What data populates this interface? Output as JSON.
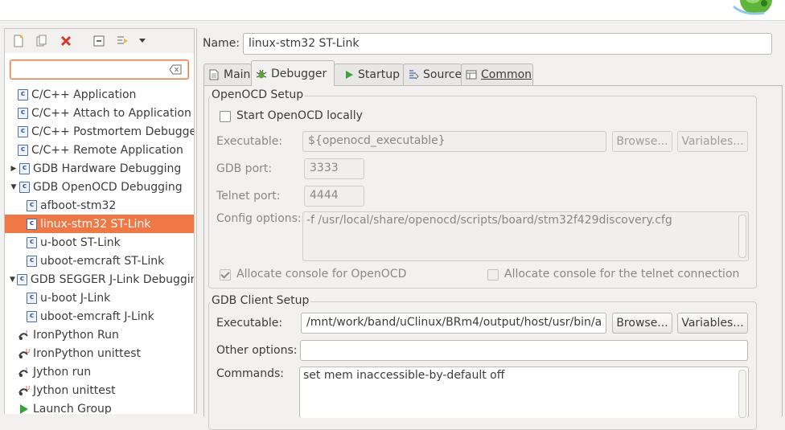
{
  "left_panel": {
    "toolbar": {
      "new_tooltip_icon": "new-config-icon",
      "duplicate_icon": "duplicate-icon",
      "delete_icon": "delete-icon",
      "collapse_icon": "collapse-all-icon",
      "filter_icon": "filter-icon",
      "menu_icon": "dropdown-menu-icon"
    },
    "filter": {
      "value": "",
      "placeholder": ""
    },
    "tree": [
      {
        "label": "C/C++ Application",
        "level": 1,
        "icon": "c-config-icon"
      },
      {
        "label": "C/C++ Attach to Application",
        "level": 1,
        "icon": "c-config-icon"
      },
      {
        "label": "C/C++ Postmortem Debugger",
        "level": 1,
        "icon": "c-config-icon"
      },
      {
        "label": "C/C++ Remote Application",
        "level": 1,
        "icon": "c-config-icon"
      },
      {
        "label": "GDB Hardware Debugging",
        "level": 0,
        "icon": "c-config-icon",
        "expanded": false
      },
      {
        "label": "GDB OpenOCD Debugging",
        "level": 0,
        "icon": "c-config-icon",
        "expanded": true
      },
      {
        "label": "afboot-stm32",
        "level": 2,
        "icon": "c-config-icon"
      },
      {
        "label": "linux-stm32 ST-Link",
        "level": 2,
        "icon": "c-config-icon",
        "selected": true
      },
      {
        "label": "u-boot ST-Link",
        "level": 2,
        "icon": "c-config-icon"
      },
      {
        "label": "uboot-emcraft ST-Link",
        "level": 2,
        "icon": "c-config-icon"
      },
      {
        "label": "GDB SEGGER J-Link Debugging",
        "level": 0,
        "icon": "c-config-icon",
        "expanded": true
      },
      {
        "label": "u-boot J-Link",
        "level": 2,
        "icon": "c-config-icon"
      },
      {
        "label": "uboot-emcraft J-Link",
        "level": 2,
        "icon": "c-config-icon"
      },
      {
        "label": "IronPython Run",
        "level": 1,
        "icon": "python-run-icon"
      },
      {
        "label": "IronPython unittest",
        "level": 1,
        "icon": "python-unittest-icon"
      },
      {
        "label": "Jython run",
        "level": 1,
        "icon": "python-run-icon"
      },
      {
        "label": "Jython unittest",
        "level": 1,
        "icon": "python-unittest-icon"
      },
      {
        "label": "Launch Group",
        "level": 1,
        "icon": "launch-group-icon"
      }
    ]
  },
  "right_panel": {
    "name_label": "Name:",
    "name_value": "linux-stm32 ST-Link",
    "tabs": [
      {
        "label": "Main",
        "icon": "main-tab-icon"
      },
      {
        "label": "Debugger",
        "icon": "debugger-tab-icon",
        "active": true
      },
      {
        "label": "Startup",
        "icon": "startup-tab-icon"
      },
      {
        "label": "Source",
        "icon": "source-tab-icon"
      },
      {
        "label": "Common",
        "icon": "common-tab-icon"
      }
    ],
    "openocd": {
      "title": "OpenOCD Setup",
      "start_locally_label": "Start OpenOCD locally",
      "start_locally_checked": false,
      "executable_label": "Executable:",
      "executable_value": "${openocd_executable}",
      "browse_label": "Browse...",
      "variables_label": "Variables...",
      "gdb_port_label": "GDB port:",
      "gdb_port_value": "3333",
      "telnet_port_label": "Telnet port:",
      "telnet_port_value": "4444",
      "config_label": "Config options:",
      "config_value": "-f /usr/local/share/openocd/scripts/board/stm32f429discovery.cfg",
      "allocate_console_label": "Allocate console for OpenOCD",
      "allocate_console_checked": true,
      "allocate_telnet_label": "Allocate console for the telnet connection",
      "allocate_telnet_checked": false
    },
    "gdb_client": {
      "title": "GDB Client Setup",
      "executable_label": "Executable:",
      "executable_value": "/mnt/work/band/uClinux/BRm4/output/host/usr/bin/a",
      "browse_label": "Browse...",
      "variables_label": "Variables...",
      "other_options_label": "Other options:",
      "other_options_value": "",
      "commands_label": "Commands:",
      "commands_value": "set mem inaccessible-by-default off"
    }
  },
  "colors": {
    "selection": "#f07746",
    "background": "#f2f1f0",
    "text": "#3c3c3c",
    "disabled_text": "#8a8886"
  }
}
